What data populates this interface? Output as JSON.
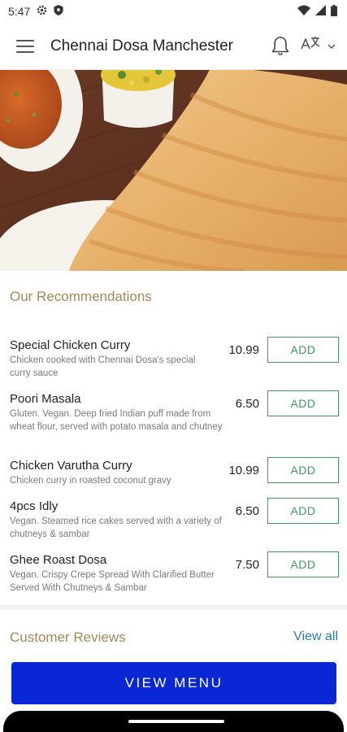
{
  "status_bar": {
    "time": "5:47"
  },
  "header": {
    "title": "Chennai Dosa Manchester"
  },
  "recommendations": {
    "title": "Our Recommendations",
    "add_label": "ADD",
    "items": [
      {
        "name": "Special Chicken Curry",
        "description": "Chicken cooked with Chennai Dosa's special curry sauce",
        "price": "10.99"
      },
      {
        "name": "Poori Masala",
        "description": "Gluten. Vegan. Deep fried Indian puff made from wheat flour, served with potato masala and chutney",
        "price": "6.50"
      },
      {
        "name": "Chicken Varutha Curry",
        "description": "Chicken curry in roasted coconut gravy",
        "price": "10.99"
      },
      {
        "name": "4pcs Idly",
        "description": "Vegan. Steamed rice cakes served with a variety of chutneys & sambar",
        "price": "6.50"
      },
      {
        "name": "Ghee Roast Dosa",
        "description": "Vegan. Crispy Crepe Spread With Clarified Butter Served With Chutneys & Sambar",
        "price": "7.50"
      }
    ]
  },
  "reviews": {
    "title": "Customer Reviews",
    "view_all": "View all"
  },
  "footer": {
    "view_menu_label": "VIEW MENU"
  },
  "colors": {
    "accent_gold": "#a08a5a",
    "add_green": "#3d9b5a",
    "link_blue": "#2f7ea7",
    "primary_button": "#0a27d6"
  }
}
